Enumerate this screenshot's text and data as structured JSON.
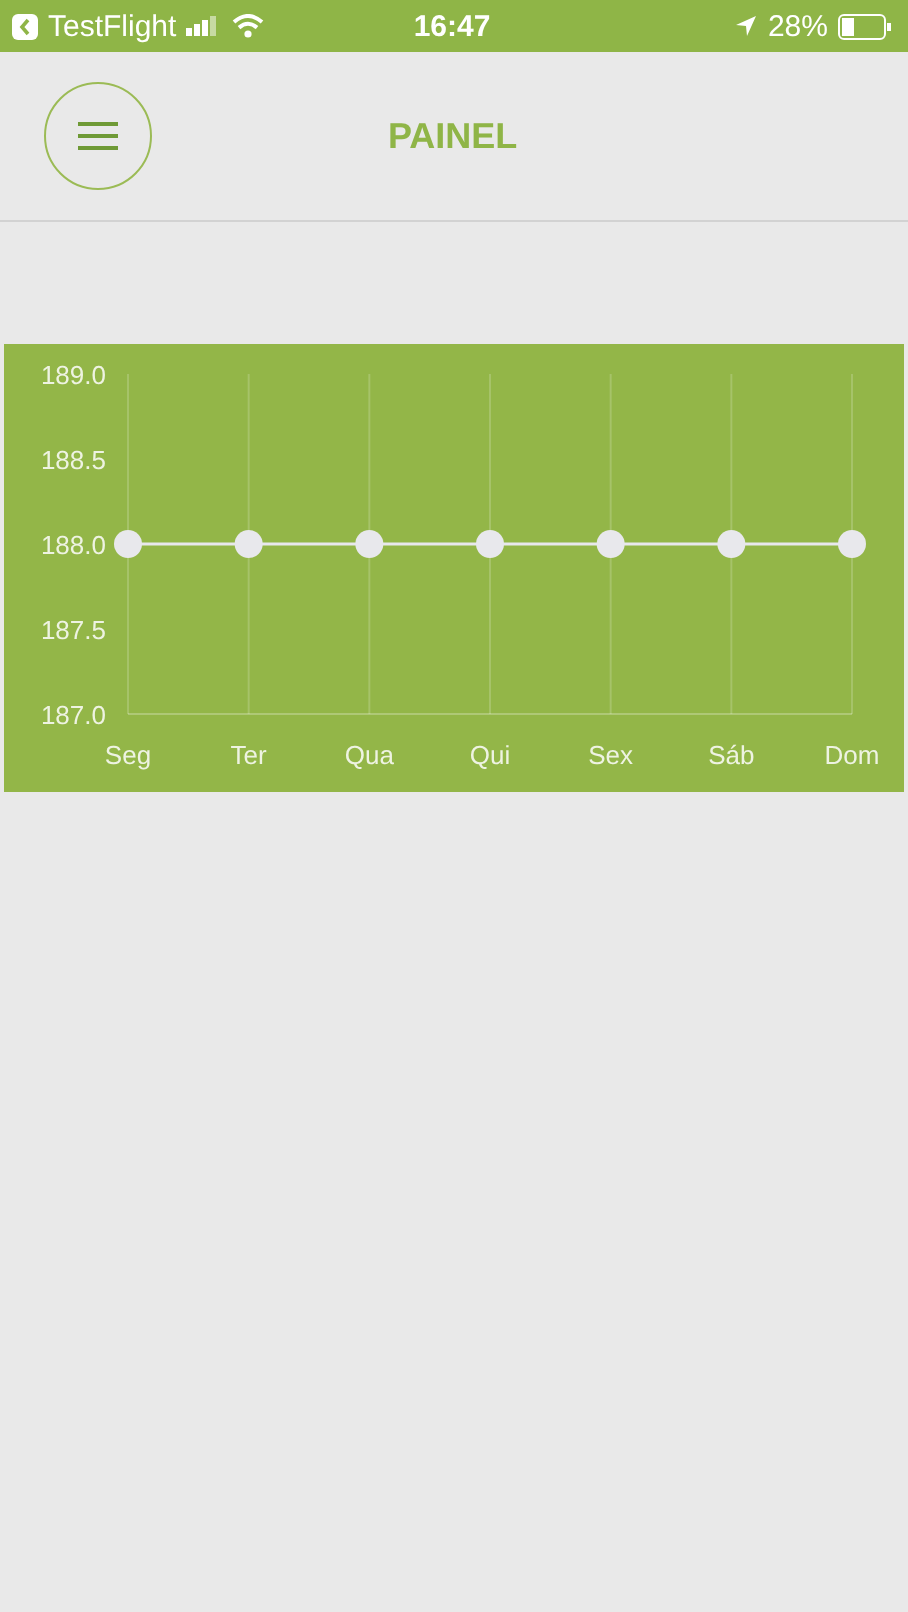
{
  "status_bar": {
    "back_app": "TestFlight",
    "time": "16:47",
    "battery": "28%"
  },
  "header": {
    "title": "PAINEL"
  },
  "chart": {
    "chart_data": {
      "type": "line",
      "categories": [
        "Seg",
        "Ter",
        "Qua",
        "Qui",
        "Sex",
        "Sáb",
        "Dom"
      ],
      "grid": true,
      "series": [
        {
          "color": "#e8e8ec",
          "marker": "circle",
          "values": [
            188,
            188,
            188,
            188,
            188,
            188,
            188
          ]
        }
      ],
      "ylim": [
        187,
        189
      ],
      "yticks": [
        {
          "value": 187,
          "label": "187.0"
        },
        {
          "value": 187.5,
          "label": "187.5"
        },
        {
          "value": 188,
          "label": "188.0"
        },
        {
          "value": 188.5,
          "label": "188.5"
        },
        {
          "value": 189,
          "label": "189.0"
        }
      ]
    }
  }
}
